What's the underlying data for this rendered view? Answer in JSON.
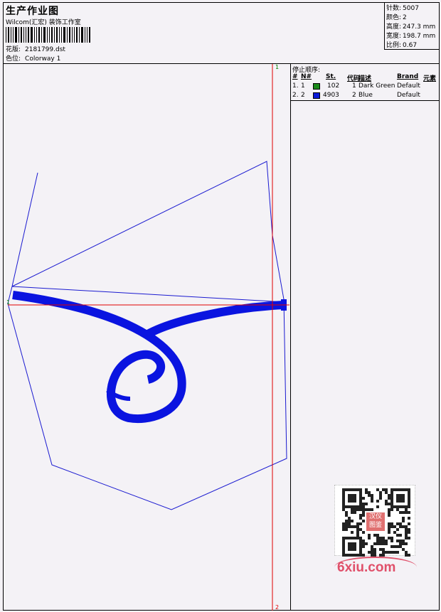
{
  "header": {
    "title": "生产作业图",
    "studio": "Wilcom(汇宏) 装饰工作室",
    "design_label": "花版:",
    "design_value": "2181799.dst",
    "colorway_label": "色位:",
    "colorway_value": "Colorway 1"
  },
  "stats": [
    {
      "key": "针数:",
      "value": "5007"
    },
    {
      "key": "颜色:",
      "value": "2"
    },
    {
      "key": "高度:",
      "value": "247.3 mm"
    },
    {
      "key": "宽度:",
      "value": "198.7 mm"
    },
    {
      "key": "比例:",
      "value": "0.67"
    }
  ],
  "stop_sequence": {
    "title": "停止顺序:",
    "headers": {
      "num": "#",
      "n": "N#",
      "st": "St.",
      "code": "代码",
      "desc": "描述",
      "brand": "Brand",
      "element": "元素"
    },
    "rows": [
      {
        "num": "1.",
        "n": "1",
        "color": "#1a8a1a",
        "st": "102",
        "code": "1",
        "desc": "Dark Green",
        "brand": "Default"
      },
      {
        "num": "2.",
        "n": "2",
        "color": "#0a1ad8",
        "st": "4903",
        "code": "2",
        "desc": "Blue",
        "brand": "Default"
      }
    ]
  },
  "canvas": {
    "guide_h_label": "1",
    "guide_v_top_label": "1",
    "guide_v_bottom_label": "2",
    "outline_color": "#1a1ad0",
    "fill_color": "#0a14e0",
    "guide_color": "#e00000"
  },
  "watermark": {
    "brand": "6xiu.com",
    "stamp": "汉仪图鉴"
  }
}
